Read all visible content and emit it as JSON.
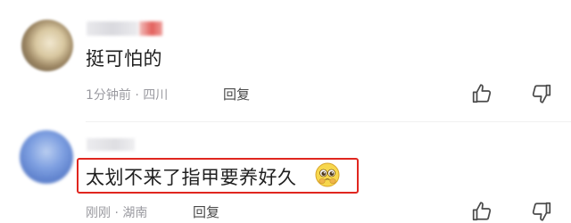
{
  "comments": [
    {
      "text": "挺可怕的",
      "meta": "1分钟前 · 四川",
      "reply_label": "回复"
    },
    {
      "text": "太划不来了指甲要养好久",
      "emoji": "pleading-face-emoji",
      "meta": "刚刚 · 湖南",
      "reply_label": "回复"
    }
  ],
  "colors": {
    "highlight_border": "#e0261f",
    "meta_text": "#9a9aa0"
  },
  "icons": {
    "like": "thumbs-up-icon",
    "dislike": "thumbs-down-icon"
  }
}
